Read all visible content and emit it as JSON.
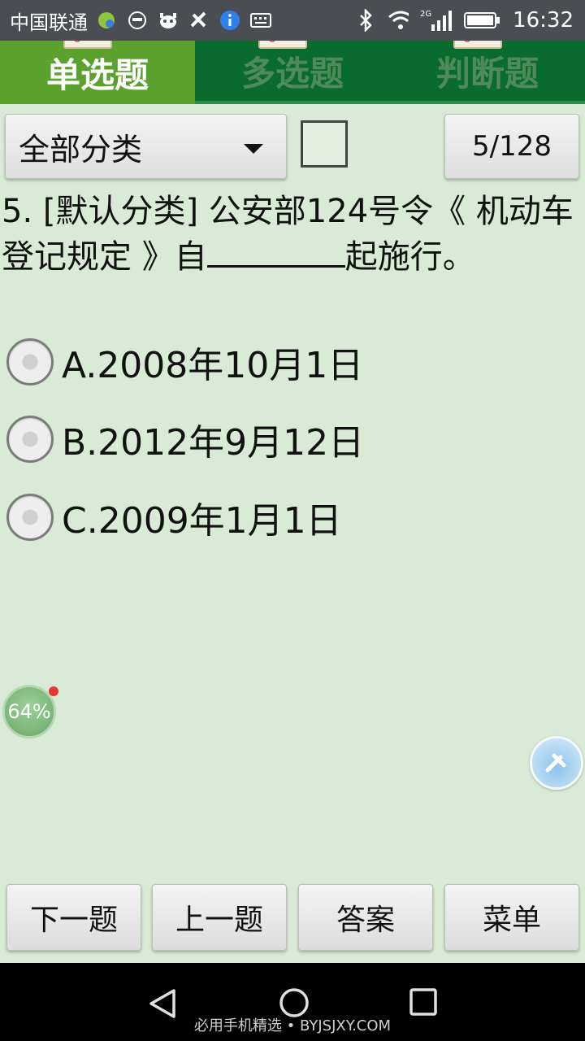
{
  "status_bar": {
    "carrier": "中国联通",
    "time": "16:32",
    "network": "2G"
  },
  "tabs": [
    {
      "label": "单选题",
      "active": true
    },
    {
      "label": "多选题",
      "active": false
    },
    {
      "label": "判断题",
      "active": false
    }
  ],
  "controls": {
    "category_selected": "全部分类",
    "progress": "5/128",
    "bookmark_checked": false
  },
  "question": {
    "text_before": "5. [默认分类] 公安部124号令《 机动车登记规定 》自",
    "text_after": "起施行。"
  },
  "options": [
    {
      "label": "A.2008年10月1日"
    },
    {
      "label": "B.2012年9月12日"
    },
    {
      "label": "C.2009年1月1日"
    }
  ],
  "floating": {
    "memory_percent": "64%"
  },
  "buttons": {
    "next": "下一题",
    "prev": "上一题",
    "answer": "答案",
    "menu": "菜单"
  },
  "watermark": "必用手机精选 • BYJSJXY.COM",
  "colors": {
    "tab_active": "#5aa12e",
    "tab_bar": "#0a6b2e",
    "background": "#d9ead6",
    "status_bar": "#4a4d52"
  }
}
